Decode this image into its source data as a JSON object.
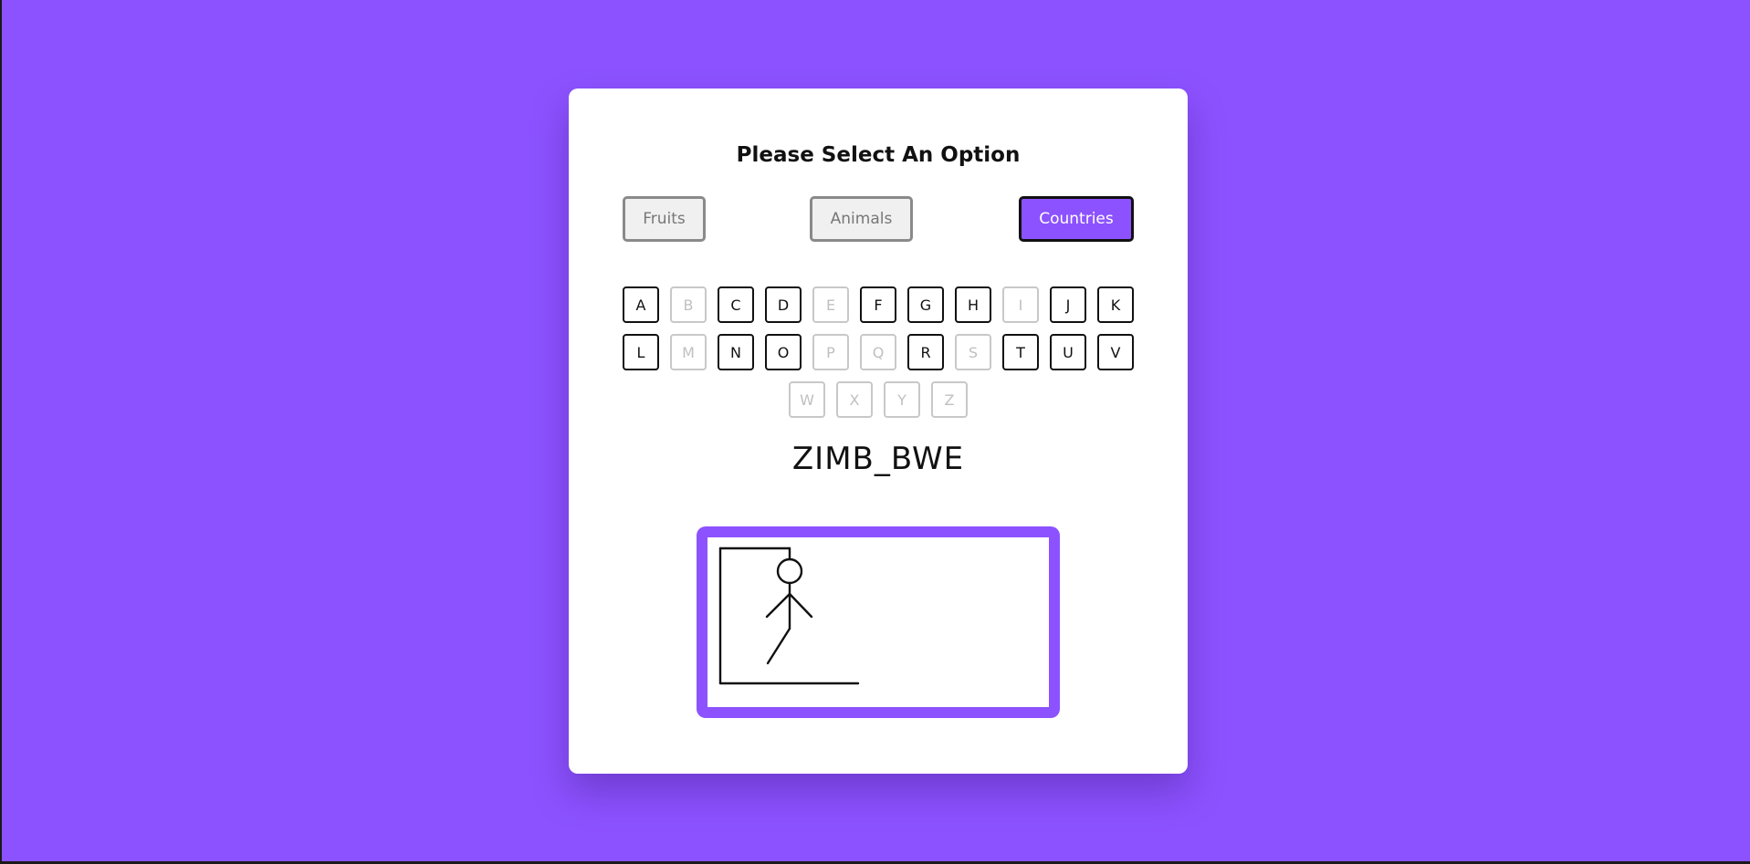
{
  "header": {
    "title": "Please Select An Option"
  },
  "options": [
    {
      "label": "Fruits",
      "selected": false
    },
    {
      "label": "Animals",
      "selected": false
    },
    {
      "label": "Countries",
      "selected": true
    }
  ],
  "keyboard": {
    "rows": [
      [
        {
          "letter": "A",
          "used": false
        },
        {
          "letter": "B",
          "used": true
        },
        {
          "letter": "C",
          "used": false
        },
        {
          "letter": "D",
          "used": false
        },
        {
          "letter": "E",
          "used": true
        },
        {
          "letter": "F",
          "used": false
        },
        {
          "letter": "G",
          "used": false
        },
        {
          "letter": "H",
          "used": false
        },
        {
          "letter": "I",
          "used": true
        },
        {
          "letter": "J",
          "used": false
        },
        {
          "letter": "K",
          "used": false
        }
      ],
      [
        {
          "letter": "L",
          "used": false
        },
        {
          "letter": "M",
          "used": true
        },
        {
          "letter": "N",
          "used": false
        },
        {
          "letter": "O",
          "used": false
        },
        {
          "letter": "P",
          "used": true
        },
        {
          "letter": "Q",
          "used": true
        },
        {
          "letter": "R",
          "used": false
        },
        {
          "letter": "S",
          "used": true
        },
        {
          "letter": "T",
          "used": false
        },
        {
          "letter": "U",
          "used": false
        },
        {
          "letter": "V",
          "used": false
        }
      ],
      [
        {
          "letter": "W",
          "used": true
        },
        {
          "letter": "X",
          "used": true
        },
        {
          "letter": "Y",
          "used": true
        },
        {
          "letter": "Z",
          "used": true
        }
      ]
    ]
  },
  "game": {
    "word_display": "ZIMB_BWE",
    "hangman_parts": [
      "gallows",
      "rope",
      "head",
      "body",
      "left-arm",
      "right-arm",
      "left-leg"
    ]
  },
  "colors": {
    "accent": "#8c52ff",
    "used_key": "#c0c0c0"
  }
}
